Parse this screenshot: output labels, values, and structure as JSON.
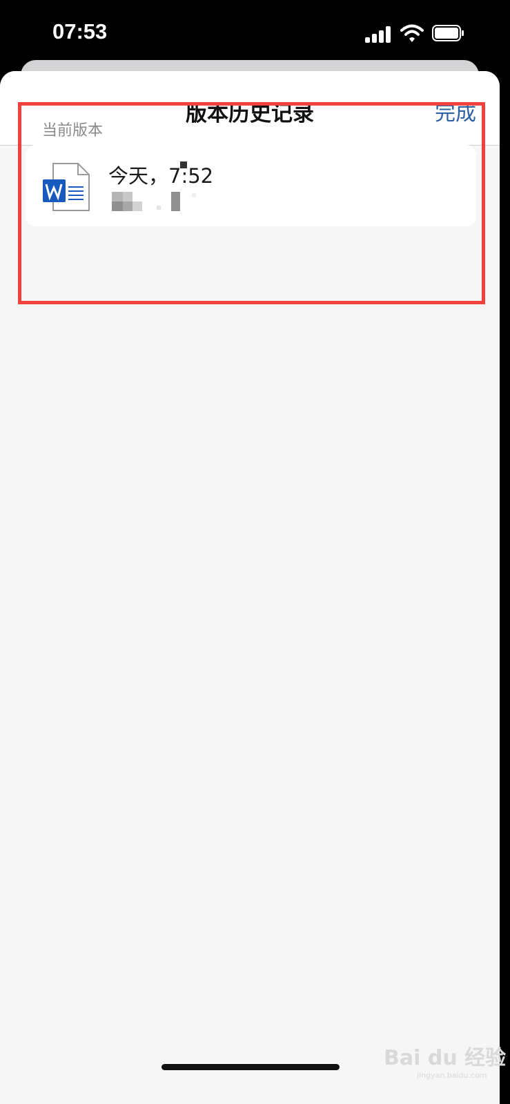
{
  "status_bar": {
    "time": "07:53",
    "icons": [
      "signal-icon",
      "wifi-icon",
      "battery-icon"
    ]
  },
  "nav": {
    "title": "版本历史记录",
    "done_label": "完成"
  },
  "section": {
    "label": "当前版本"
  },
  "version": {
    "timestamp": "今天，7:52",
    "file_type_icon": "word-document-icon"
  },
  "watermark": {
    "brand": "Bai du 经验",
    "domain": "jingyan.baidu.com"
  },
  "colors": {
    "accent": "#2d5fa3",
    "highlight": "#f0413b",
    "word_blue": "#185abd"
  }
}
